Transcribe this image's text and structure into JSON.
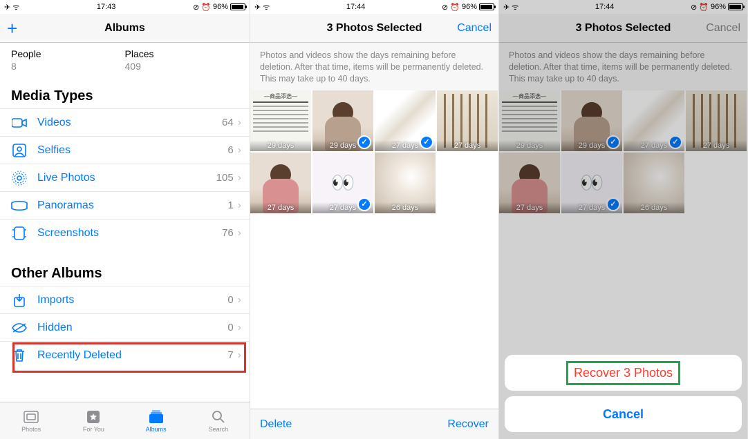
{
  "panel1": {
    "status": {
      "time": "17:43",
      "battery": "96%"
    },
    "nav": {
      "title": "Albums"
    },
    "counts": [
      {
        "label": "People",
        "value": "8"
      },
      {
        "label": "Places",
        "value": "409"
      }
    ],
    "sections": {
      "media_title": "Media Types",
      "media": [
        {
          "icon": "video",
          "label": "Videos",
          "count": "64"
        },
        {
          "icon": "selfie",
          "label": "Selfies",
          "count": "6"
        },
        {
          "icon": "live",
          "label": "Live Photos",
          "count": "105"
        },
        {
          "icon": "pano",
          "label": "Panoramas",
          "count": "1"
        },
        {
          "icon": "screenshot",
          "label": "Screenshots",
          "count": "76"
        }
      ],
      "other_title": "Other Albums",
      "other": [
        {
          "icon": "import",
          "label": "Imports",
          "count": "0"
        },
        {
          "icon": "hidden",
          "label": "Hidden",
          "count": "0"
        },
        {
          "icon": "trash",
          "label": "Recently Deleted",
          "count": "7"
        }
      ]
    },
    "tabs": [
      {
        "label": "Photos"
      },
      {
        "label": "For You"
      },
      {
        "label": "Albums"
      },
      {
        "label": "Search"
      }
    ]
  },
  "panel2": {
    "status": {
      "time": "17:44",
      "battery": "96%"
    },
    "nav": {
      "title": "3 Photos Selected",
      "cancel": "Cancel"
    },
    "desc": "Photos and videos show the days remaining before deletion. After that time, items will be permanently deleted. This may take up to 40 days.",
    "thumbs": [
      {
        "days": "29 days",
        "kind": "text",
        "selected": false
      },
      {
        "days": "29 days",
        "kind": "person",
        "selected": true
      },
      {
        "days": "27 days",
        "kind": "blur",
        "selected": true
      },
      {
        "days": "27 days",
        "kind": "sticks",
        "selected": false
      },
      {
        "days": "27 days",
        "kind": "personpink",
        "selected": false
      },
      {
        "days": "27 days",
        "kind": "eyes",
        "selected": true
      },
      {
        "days": "26 days",
        "kind": "light",
        "selected": false
      }
    ],
    "toolbar": {
      "delete": "Delete",
      "recover": "Recover"
    }
  },
  "panel3": {
    "status": {
      "time": "17:44",
      "battery": "96%"
    },
    "nav": {
      "title": "3 Photos Selected",
      "cancel": "Cancel"
    },
    "desc": "Photos and videos show the days remaining before deletion. After that time, items will be permanently deleted. This may take up to 40 days.",
    "thumbs": [
      {
        "days": "29 days",
        "kind": "text",
        "selected": false
      },
      {
        "days": "29 days",
        "kind": "person",
        "selected": true
      },
      {
        "days": "27 days",
        "kind": "blur",
        "selected": true
      },
      {
        "days": "27 days",
        "kind": "sticks",
        "selected": false
      },
      {
        "days": "27 days",
        "kind": "personpink",
        "selected": false
      },
      {
        "days": "27 days",
        "kind": "eyes",
        "selected": true
      },
      {
        "days": "26 days",
        "kind": "light",
        "selected": false
      }
    ],
    "sheet": {
      "recover": "Recover 3 Photos",
      "cancel": "Cancel"
    }
  },
  "icons": {
    "airplane": "✈︎",
    "wifi": "ᯤ",
    "alarm": "⏰",
    "lock": "🔒",
    "eyes": "👀"
  }
}
